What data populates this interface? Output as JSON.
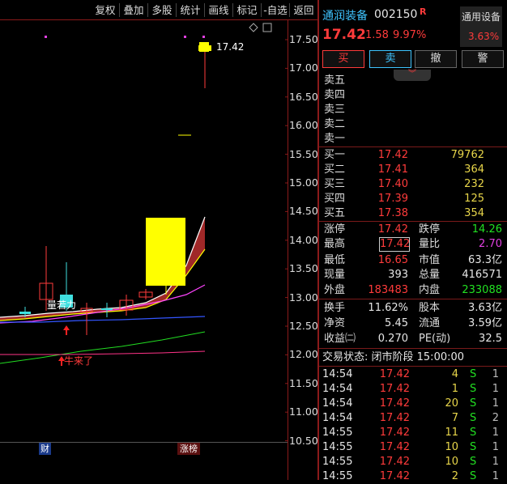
{
  "toolbar": {
    "buttons": [
      "复权",
      "叠加",
      "多股",
      "统计",
      "画线",
      "标记",
      "-自选",
      "返回"
    ]
  },
  "chart": {
    "price_labels": [
      "17.50",
      "17.00",
      "16.50",
      "16.00",
      "15.50",
      "15.00",
      "14.50",
      "14.00",
      "13.50",
      "13.00",
      "12.50",
      "12.00",
      "11.50",
      "11.00",
      "10.50"
    ],
    "last_price_tag": "17.42",
    "annotation_volume": "量若力",
    "annotation_arrival": "牛来了",
    "bottom_tag_finance": "财",
    "bottom_tag_limit": "涨榜",
    "colors": {
      "up": "#ff3b3b",
      "down": "#3fe0e0",
      "limit": "#ffff00",
      "ma_white": "#ffffff",
      "ma_yellow": "#ffff00",
      "ma_magenta": "#ff44ff",
      "ma_green": "#22dd22",
      "ma_blue": "#3355ff",
      "ma_pink": "#ff3388"
    }
  },
  "stock": {
    "name": "通润装备",
    "code": "002150",
    "badge": "R",
    "price": "17.42",
    "change": "1.58",
    "change_pct": "9.97%",
    "device_label": "通用设备",
    "device_pct": "3.63%"
  },
  "trade_buttons": {
    "buy": "买",
    "sell": "卖",
    "cancel": "撤",
    "alert": "警"
  },
  "sell_levels": [
    {
      "label": "卖五"
    },
    {
      "label": "卖四"
    },
    {
      "label": "卖三"
    },
    {
      "label": "卖二"
    },
    {
      "label": "卖一"
    }
  ],
  "buy_levels": [
    {
      "label": "买一",
      "price": "17.42",
      "volume": "79762"
    },
    {
      "label": "买二",
      "price": "17.41",
      "volume": "364"
    },
    {
      "label": "买三",
      "price": "17.40",
      "volume": "232"
    },
    {
      "label": "买四",
      "price": "17.39",
      "volume": "125"
    },
    {
      "label": "买五",
      "price": "17.38",
      "volume": "354"
    }
  ],
  "stats": {
    "limit_up_label": "涨停",
    "limit_up": "17.42",
    "limit_down_label": "跌停",
    "limit_down": "14.26",
    "high_label": "最高",
    "high": "17.42",
    "vol_ratio_label": "量比",
    "vol_ratio": "2.70",
    "low_label": "最低",
    "low": "16.65",
    "mkt_cap_label": "市值",
    "mkt_cap": "63.3亿",
    "cur_vol_label": "现量",
    "cur_vol": "393",
    "total_vol_label": "总量",
    "total_vol": "416571",
    "outer_label": "外盘",
    "outer": "183483",
    "inner_label": "内盘",
    "inner": "233088",
    "turnover_label": "换手",
    "turnover": "11.62%",
    "shares_label": "股本",
    "shares": "3.63亿",
    "nav_label": "净资",
    "nav": "5.45",
    "float_label": "流通",
    "float": "3.59亿",
    "eps_label": "收益㈡",
    "eps": "0.270",
    "pe_label": "PE(动)",
    "pe": "32.5"
  },
  "trade_status": "交易状态: 闭市阶段 15:00:00",
  "ticks": [
    {
      "time": "14:54",
      "price": "17.42",
      "vol": "4",
      "side": "S",
      "n": "1"
    },
    {
      "time": "14:54",
      "price": "17.42",
      "vol": "1",
      "side": "S",
      "n": "1"
    },
    {
      "time": "14:54",
      "price": "17.42",
      "vol": "20",
      "side": "S",
      "n": "1"
    },
    {
      "time": "14:54",
      "price": "17.42",
      "vol": "7",
      "side": "S",
      "n": "2"
    },
    {
      "time": "14:55",
      "price": "17.42",
      "vol": "11",
      "side": "S",
      "n": "1"
    },
    {
      "time": "14:55",
      "price": "17.42",
      "vol": "10",
      "side": "S",
      "n": "1"
    },
    {
      "time": "14:55",
      "price": "17.42",
      "vol": "10",
      "side": "S",
      "n": "1"
    },
    {
      "time": "14:55",
      "price": "17.42",
      "vol": "2",
      "side": "S",
      "n": "1"
    }
  ]
}
